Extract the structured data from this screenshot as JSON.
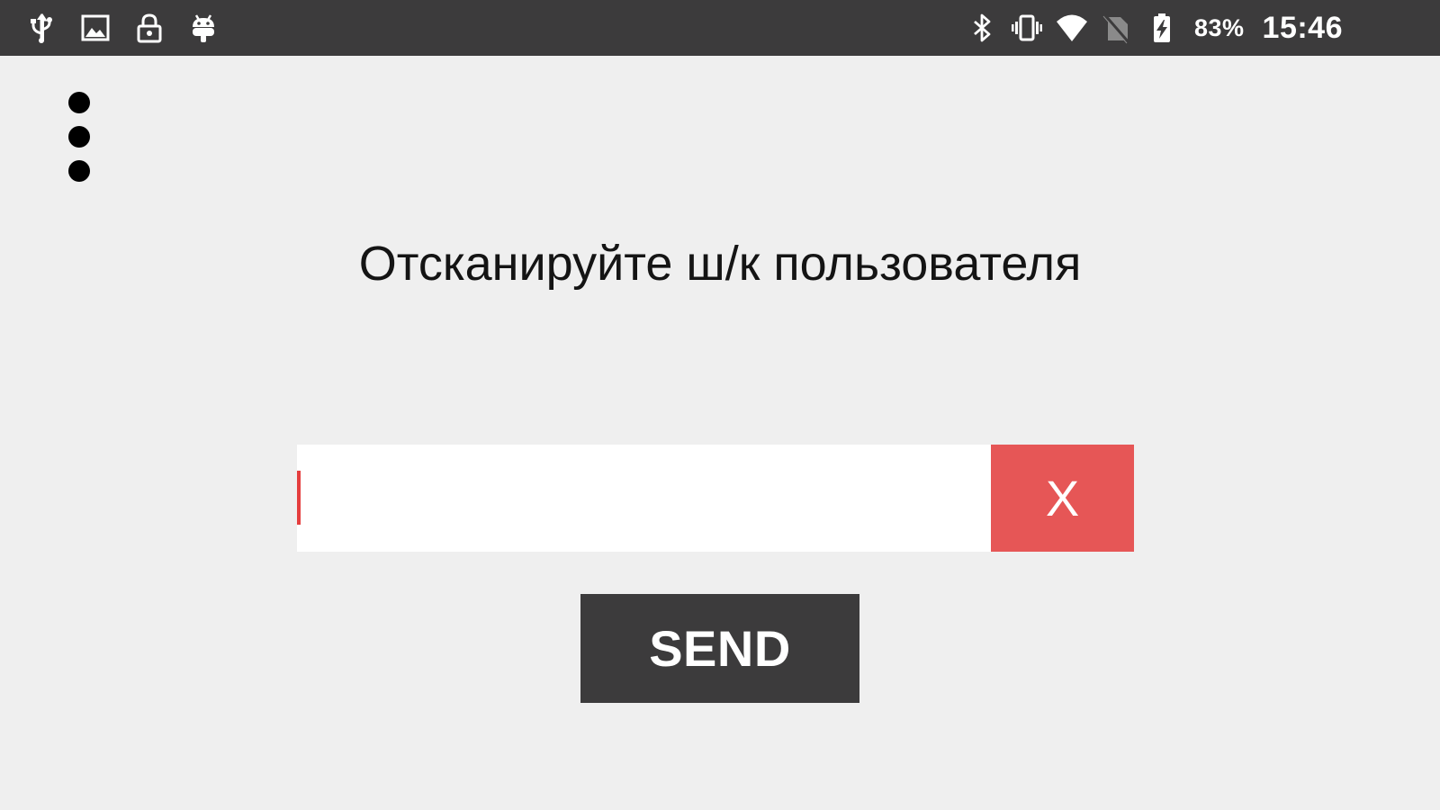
{
  "status_bar": {
    "left_icons": [
      "usb-icon",
      "image-icon",
      "lock-icon",
      "android-icon"
    ],
    "right_icons": [
      "bluetooth-icon",
      "vibrate-icon",
      "wifi-icon",
      "no-sim-icon",
      "battery-charging-icon"
    ],
    "battery_percent": "83%",
    "time": "15:46"
  },
  "toolbar": {
    "menu_icon": "more-vert-icon"
  },
  "main": {
    "prompt": "Отсканируйте ш/к пользователя",
    "barcode_input": {
      "value": "",
      "placeholder": ""
    },
    "clear_label": "X",
    "send_label": "SEND"
  },
  "colors": {
    "status_bar_bg": "#3c3b3c",
    "background": "#efefef",
    "clear_button_bg": "#e65656",
    "send_button_bg": "#3c3b3c",
    "caret": "#e53e3e"
  }
}
